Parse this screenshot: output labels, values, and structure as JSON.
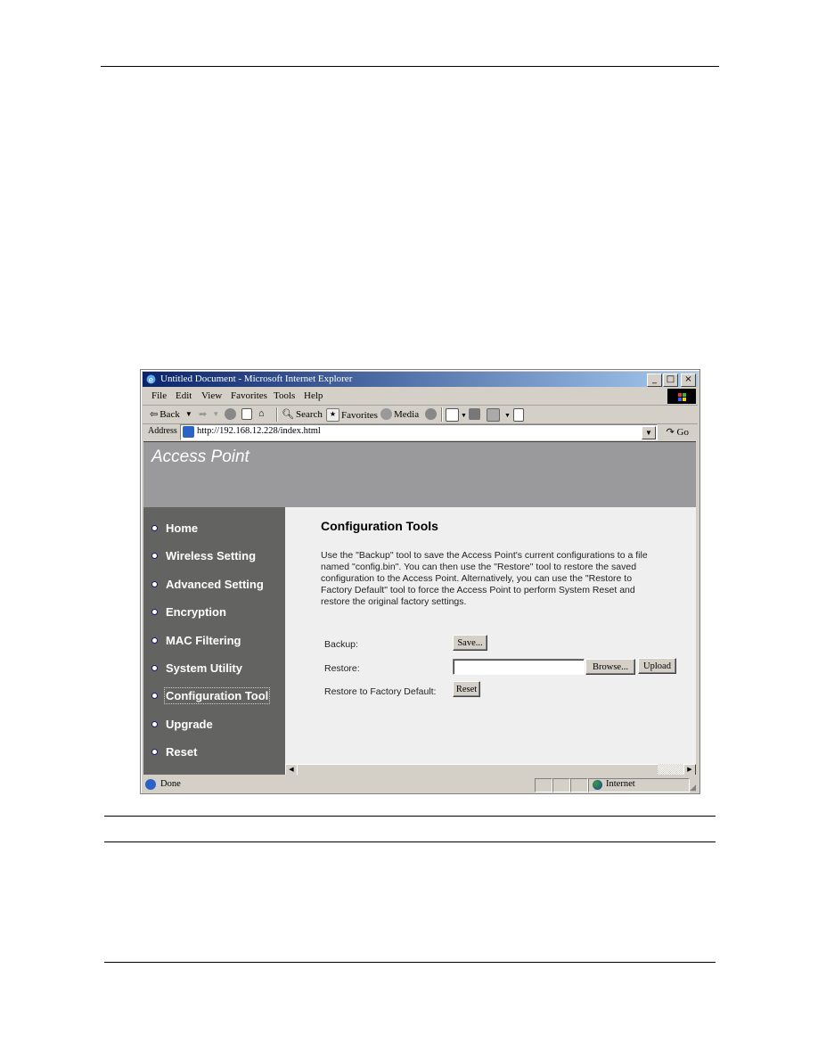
{
  "browser": {
    "window_title": "Untitled Document - Microsoft Internet Explorer",
    "window_controls": [
      "minimize",
      "maximize",
      "close"
    ],
    "menu": [
      "File",
      "Edit",
      "View",
      "Favorites",
      "Tools",
      "Help"
    ],
    "toolbar": {
      "back_label": "Back",
      "search_label": "Search",
      "favorites_label": "Favorites",
      "media_label": "Media"
    },
    "address": {
      "label": "Address",
      "url": "http://192.168.12.228/index.html",
      "go_label": "Go"
    },
    "status": {
      "text": "Done",
      "zone": "Internet"
    }
  },
  "page": {
    "brand": "Access Point",
    "nav": [
      {
        "label": "Home",
        "active": false
      },
      {
        "label": "Wireless Setting",
        "active": false
      },
      {
        "label": "Advanced Setting",
        "active": false
      },
      {
        "label": "Encryption",
        "active": false
      },
      {
        "label": "MAC Filtering",
        "active": false
      },
      {
        "label": "System Utility",
        "active": false
      },
      {
        "label": "Configuration Tool",
        "active": true
      },
      {
        "label": "Upgrade",
        "active": false
      },
      {
        "label": "Reset",
        "active": false
      }
    ],
    "title": "Configuration Tools",
    "description": "Use the \"Backup\" tool to save the Access Point's current configurations to a file named \"config.bin\". You can then use the \"Restore\" tool to restore the saved configuration to the Access Point. Alternatively, you can use the \"Restore to Factory Default\" tool to force the Access Point to perform System Reset and restore the original factory settings.",
    "form": {
      "backup_label": "Backup:",
      "save_button": "Save...",
      "restore_label": "Restore:",
      "restore_file_value": "",
      "browse_button": "Browse...",
      "upload_button": "Upload",
      "factory_label": "Restore to Factory Default:",
      "reset_button": "Reset"
    }
  },
  "colors": {
    "banner": "#9a999b",
    "sidebar": "#636462",
    "content_bg": "#efefef",
    "titlebar_start": "#0a246a",
    "titlebar_end": "#a6caf0"
  }
}
